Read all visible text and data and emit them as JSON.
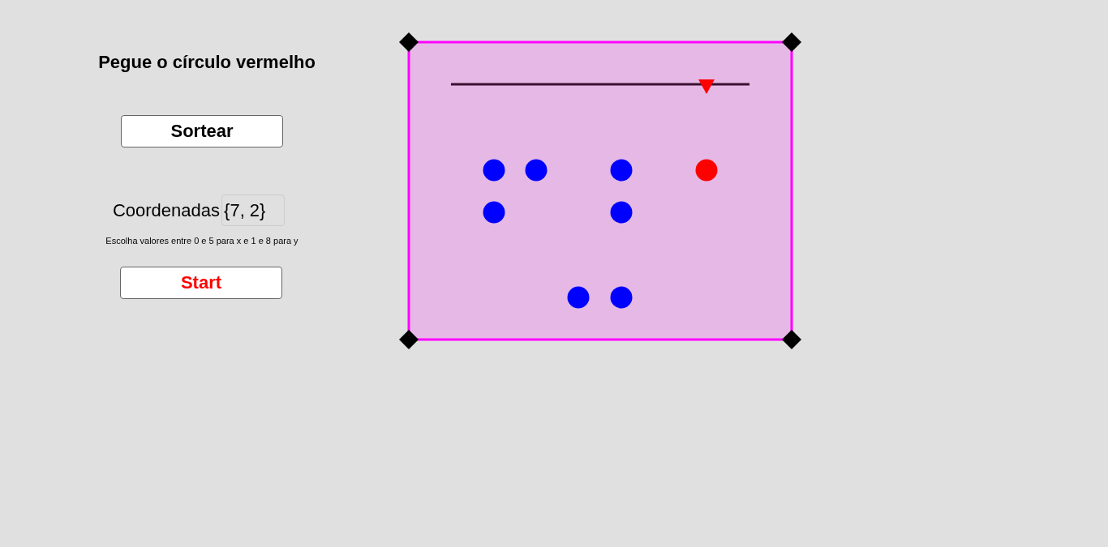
{
  "title": "Pegue o círculo vermelho",
  "draw_button": {
    "label": "Sortear"
  },
  "coordinates": {
    "label": "Coordenadas",
    "value": "{7, 2}"
  },
  "hint": "Escolha valores entre 0 e 5 para x e 1 e 8 para y",
  "start_button": {
    "label": "Start"
  },
  "slider": {
    "level": 0.856
  },
  "circles": [
    {
      "color": "#0000ff"
    },
    {
      "color": "#0000ff"
    },
    {
      "color": "#0000ff"
    },
    {
      "color": "#ff0000"
    },
    {
      "color": "#0000ff"
    },
    {
      "color": "#0000ff"
    },
    {
      "color": "#0000ff"
    },
    {
      "color": "#0000ff"
    }
  ]
}
